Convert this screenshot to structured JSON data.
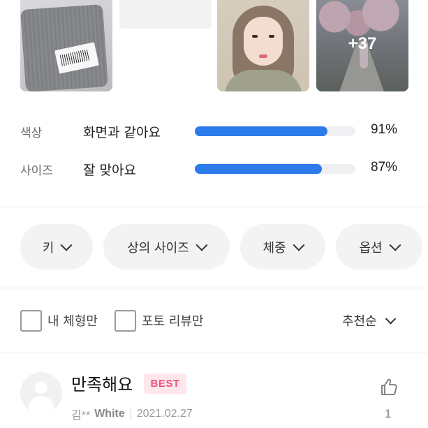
{
  "photos": {
    "extra_count_label": "+37"
  },
  "ratings": [
    {
      "label": "색상",
      "value": "화면과 같아요",
      "percent_label": "91%",
      "percent": 91
    },
    {
      "label": "사이즈",
      "value": "잘 맞아요",
      "percent_label": "87%",
      "percent": 87
    }
  ],
  "colors": {
    "accent": "#2b7bea",
    "best_badge_bg": "#fde6ec",
    "best_badge_text": "#e8587a"
  },
  "filters": [
    {
      "label": "키",
      "icon": "chevron-down-icon"
    },
    {
      "label": "상의 사이즈",
      "icon": "chevron-down-icon"
    },
    {
      "label": "체중",
      "icon": "chevron-down-icon"
    },
    {
      "label": "옵션",
      "icon": "chevron-down-icon"
    }
  ],
  "toggles": {
    "my_body_type": "내 체형만",
    "photo_review": "포토 리뷰만"
  },
  "sort": {
    "label": "추천순",
    "icon": "chevron-down-icon"
  },
  "review": {
    "title": "만족해요",
    "badge": "BEST",
    "author": "김**",
    "option": "White",
    "date": "2021.02.27",
    "like_count": "1",
    "like_icon": "thumbs-up-icon",
    "avatar_icon": "user-avatar-icon"
  }
}
